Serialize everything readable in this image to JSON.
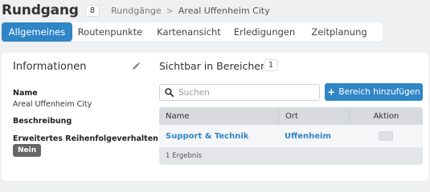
{
  "header": {
    "title": "Rundgang",
    "count": "8",
    "breadcrumb": {
      "parent": "Rundgänge",
      "separator": ">",
      "current": "Areal Uffenheim City"
    }
  },
  "tabs": [
    {
      "label": "Allgemeines",
      "active": true
    },
    {
      "label": "Routenpunkte",
      "active": false
    },
    {
      "label": "Kartenansicht",
      "active": false
    },
    {
      "label": "Erledigungen",
      "active": false
    },
    {
      "label": "Zeitplanung",
      "active": false
    }
  ],
  "info": {
    "title": "Informationen",
    "name_label": "Name",
    "name_value": "Areal Uffenheim City",
    "description_label": "Beschreibung",
    "order_label": "Erweitertes Reihenfolgeverhalten",
    "order_value": "Nein"
  },
  "areas": {
    "title": "Sichtbar in Bereichen",
    "count": "1",
    "search_placeholder": "Suchen",
    "add_button": "Bereich hinzufügen",
    "columns": [
      "Name",
      "Ort",
      "Aktion"
    ],
    "rows": [
      {
        "name": "Support & Technik",
        "ort": "Uffenheim"
      }
    ],
    "footer": "1 Ergebnis"
  },
  "colors": {
    "accent": "#2f86c6",
    "badge_gray": "#666666",
    "background": "#eef0f2"
  },
  "icons": [
    "pencil-icon",
    "info-circle-icon",
    "search-icon",
    "plus-icon"
  ]
}
